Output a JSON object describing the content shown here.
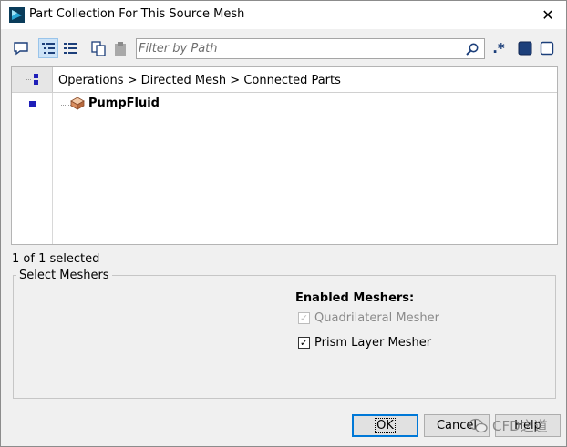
{
  "window": {
    "title": "Part Collection For This Source Mesh",
    "close_symbol": "✕"
  },
  "toolbar": {
    "filter_placeholder": "Filter by Path",
    "regex_symbol": ".*"
  },
  "tree": {
    "path": "Operations > Directed Mesh > Connected Parts",
    "items": [
      {
        "label": "PumpFluid"
      }
    ]
  },
  "status": "1 of 1 selected",
  "meshers": {
    "group_title": "Select Meshers",
    "enabled_title": "Enabled Meshers:",
    "options": [
      {
        "label": "Quadrilateral Mesher",
        "checked": true,
        "enabled": false
      },
      {
        "label": "Prism Layer Mesher",
        "checked": true,
        "enabled": true
      }
    ]
  },
  "buttons": {
    "ok": "OK",
    "cancel": "Cancel",
    "help": "Help"
  },
  "watermark": "CFD之道",
  "colors": {
    "accent": "#0078d7",
    "selection_marker": "#1f1fb8",
    "toolbar_active": "#cde3f7"
  }
}
